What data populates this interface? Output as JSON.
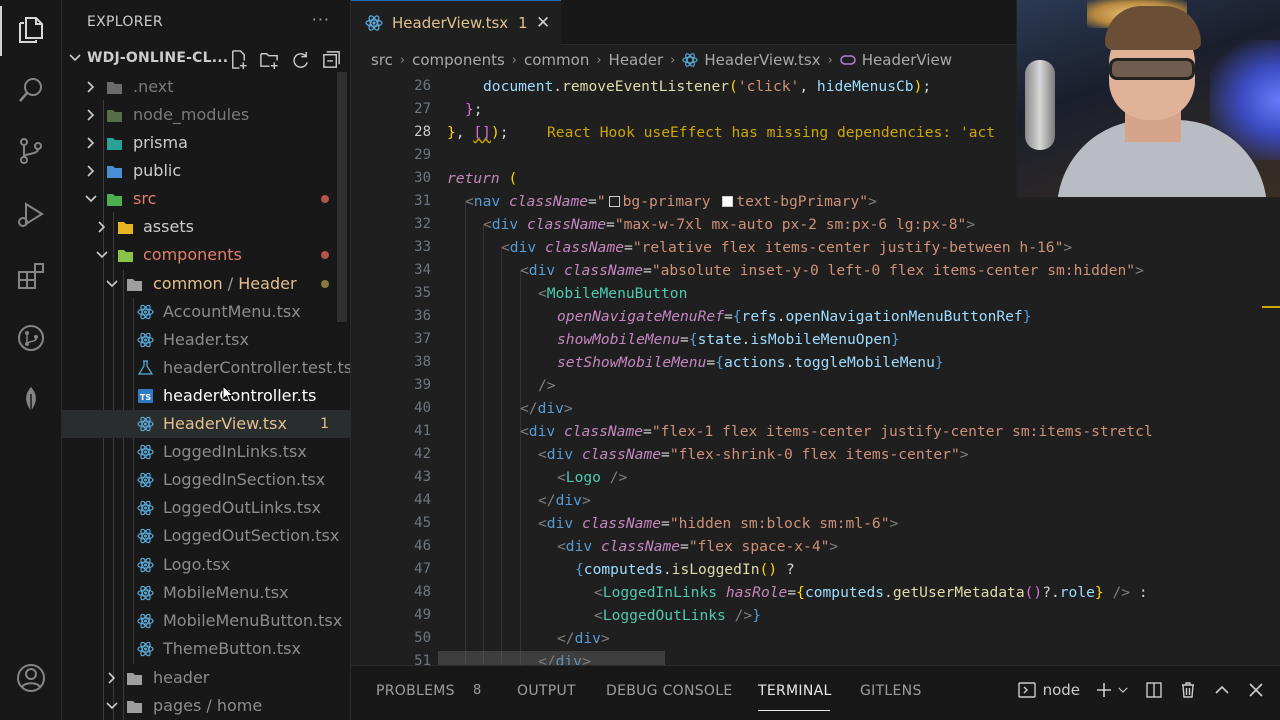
{
  "explorer": {
    "title": "EXPLORER",
    "more": "···",
    "project": "WDJ-ONLINE-CL...",
    "items": [
      {
        "label": ".next",
        "color": "#7a7a7a",
        "kind": "folder"
      },
      {
        "label": "node_modules",
        "color": "#7a7a7a",
        "kind": "folder"
      },
      {
        "label": "prisma",
        "color": "#cccccc",
        "kind": "folder"
      },
      {
        "label": "public",
        "color": "#cccccc",
        "kind": "folder"
      },
      {
        "label": "src",
        "color": "#e27e6d",
        "kind": "folder-open"
      },
      {
        "label": "assets",
        "color": "#cccccc",
        "kind": "folder"
      },
      {
        "label": "components",
        "color": "#e27e6d",
        "kind": "folder-open"
      },
      {
        "label": "common",
        "sep": "/",
        "label2": "Header",
        "color": "#e2c08d",
        "kind": "folder-open"
      },
      {
        "label": "AccountMenu.tsx",
        "color": "#8c8c8c",
        "kind": "react"
      },
      {
        "label": "Header.tsx",
        "color": "#8c8c8c",
        "kind": "react"
      },
      {
        "label": "headerController.test.ts",
        "color": "#8c8c8c",
        "kind": "test"
      },
      {
        "label": "headerController.ts",
        "color": "#ffffff",
        "kind": "ts"
      },
      {
        "label": "HeaderView.tsx",
        "color": "#e2c08d",
        "kind": "react",
        "badge": "1"
      },
      {
        "label": "LoggedInLinks.tsx",
        "color": "#8c8c8c",
        "kind": "react"
      },
      {
        "label": "LoggedInSection.tsx",
        "color": "#8c8c8c",
        "kind": "react"
      },
      {
        "label": "LoggedOutLinks.tsx",
        "color": "#8c8c8c",
        "kind": "react"
      },
      {
        "label": "LoggedOutSection.tsx",
        "color": "#8c8c8c",
        "kind": "react"
      },
      {
        "label": "Logo.tsx",
        "color": "#8c8c8c",
        "kind": "react"
      },
      {
        "label": "MobileMenu.tsx",
        "color": "#8c8c8c",
        "kind": "react"
      },
      {
        "label": "MobileMenuButton.tsx",
        "color": "#8c8c8c",
        "kind": "react"
      },
      {
        "label": "ThemeButton.tsx",
        "color": "#8c8c8c",
        "kind": "react"
      },
      {
        "label": "header",
        "color": "#8c8c8c",
        "kind": "folder"
      },
      {
        "label": "pages",
        "sep": "/",
        "label2": "home",
        "color": "#8c8c8c",
        "kind": "folder-open"
      }
    ]
  },
  "tab": {
    "name": "HeaderView.tsx",
    "problems": "1",
    "close": "✕"
  },
  "breadcrumb": [
    "src",
    "components",
    "common",
    "Header",
    "HeaderView.tsx",
    "HeaderView"
  ],
  "code": {
    "active_line": "28",
    "lines": [
      {
        "n": "26",
        "text": "document.removeEventListener('click', hideMenusCb);"
      },
      {
        "n": "27",
        "text": "};"
      },
      {
        "n": "28",
        "text": "}, []);",
        "warning": "React Hook useEffect has missing dependencies: 'act"
      },
      {
        "n": "29",
        "text": ""
      },
      {
        "n": "30",
        "text": "return ("
      },
      {
        "n": "31",
        "text": "<nav className=\"bg-primary text-bgPrimary\">"
      },
      {
        "n": "32",
        "text": "<div className=\"max-w-7xl mx-auto px-2 sm:px-6 lg:px-8\">"
      },
      {
        "n": "33",
        "text": "<div className=\"relative flex items-center justify-between h-16\">"
      },
      {
        "n": "34",
        "text": "<div className=\"absolute inset-y-0 left-0 flex items-center sm:hidden\">"
      },
      {
        "n": "35",
        "text": "<MobileMenuButton"
      },
      {
        "n": "36",
        "text": "openNavigateMenuRef={refs.openNavigationMenuButtonRef}"
      },
      {
        "n": "37",
        "text": "showMobileMenu={state.isMobileMenuOpen}"
      },
      {
        "n": "38",
        "text": "setShowMobileMenu={actions.toggleMobileMenu}"
      },
      {
        "n": "39",
        "text": "/>"
      },
      {
        "n": "40",
        "text": "</div>"
      },
      {
        "n": "41",
        "text": "<div className=\"flex-1 flex items-center justify-center sm:items-stretcl"
      },
      {
        "n": "42",
        "text": "<div className=\"flex-shrink-0 flex items-center\">"
      },
      {
        "n": "43",
        "text": "<Logo />"
      },
      {
        "n": "44",
        "text": "</div>"
      },
      {
        "n": "45",
        "text": "<div className=\"hidden sm:block sm:ml-6\">"
      },
      {
        "n": "46",
        "text": "<div className=\"flex space-x-4\">"
      },
      {
        "n": "47",
        "text": "{computeds.isLoggedIn() ?"
      },
      {
        "n": "48",
        "text": "<LoggedInLinks hasRole={computeds.getUserMetadata()?.role} /> :"
      },
      {
        "n": "49",
        "text": "<LoggedOutLinks />}"
      },
      {
        "n": "50",
        "text": "</div>"
      },
      {
        "n": "51",
        "text": "</div>"
      }
    ]
  },
  "panel": {
    "tabs": [
      "PROBLEMS",
      "OUTPUT",
      "DEBUG CONSOLE",
      "TERMINAL",
      "GITLENS"
    ],
    "problems_count": "8",
    "active_tab": "TERMINAL",
    "terminal_label": "node"
  },
  "colors": {
    "accent": "#e2c08d",
    "warning": "#cca700",
    "modified": "#e27e6d"
  }
}
